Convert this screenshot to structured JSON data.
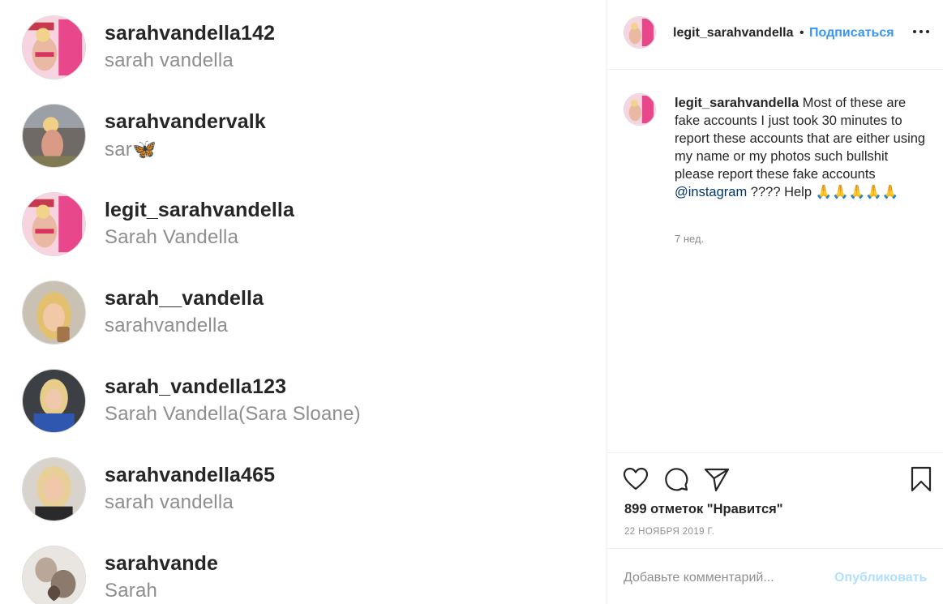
{
  "results": [
    {
      "username": "sarahvandella142",
      "fullname": "sarah vandella",
      "avatar": "pink-poster-avatar"
    },
    {
      "username": "sarahvandervalk",
      "fullname": "sar🦋",
      "avatar": "blonde-woman-avatar"
    },
    {
      "username": "legit_sarahvandella",
      "fullname": "Sarah Vandella",
      "avatar": "pink-poster-avatar"
    },
    {
      "username": "sarah__vandella",
      "fullname": "sarahvandella",
      "avatar": "selfie-avatar"
    },
    {
      "username": "sarah_vandella123",
      "fullname": "Sarah Vandella(Sara Sloane)",
      "avatar": "car-selfie-avatar"
    },
    {
      "username": "sarahvandella465",
      "fullname": "sarah vandella",
      "avatar": "selfie-avatar"
    },
    {
      "username": "sarahvande",
      "fullname": "Sarah",
      "avatar": "couple-avatar"
    }
  ],
  "post": {
    "header": {
      "username": "legit_sarahvandella",
      "separator": "•",
      "follow_label": "Подписаться",
      "more_icon": "more-options-icon"
    },
    "caption": {
      "username": "legit_sarahvandella",
      "text_before_mention": " Most of these are fake accounts I just took 30 minutes to report these accounts that are either using my name or my photos such bullshit please report these fake accounts ",
      "mention": "@instagram",
      "text_after_mention": " ???? Help 🙏🙏🙏🙏🙏",
      "time": "7 нед."
    },
    "actions": {
      "icons": [
        "heart-icon",
        "comment-icon",
        "share-icon",
        "bookmark-icon"
      ],
      "likes": "899 отметок \"Нравится\"",
      "date": "22 НОЯБРЯ 2019 Г."
    },
    "comment_box": {
      "placeholder": "Добавьте комментарий...",
      "publish_label": "Опубликовать"
    }
  },
  "colors": {
    "link_blue": "#3897f0",
    "publish_disabled": "#b2dffc",
    "mention": "#003569",
    "muted": "#8e8e8e",
    "text": "#262626"
  }
}
